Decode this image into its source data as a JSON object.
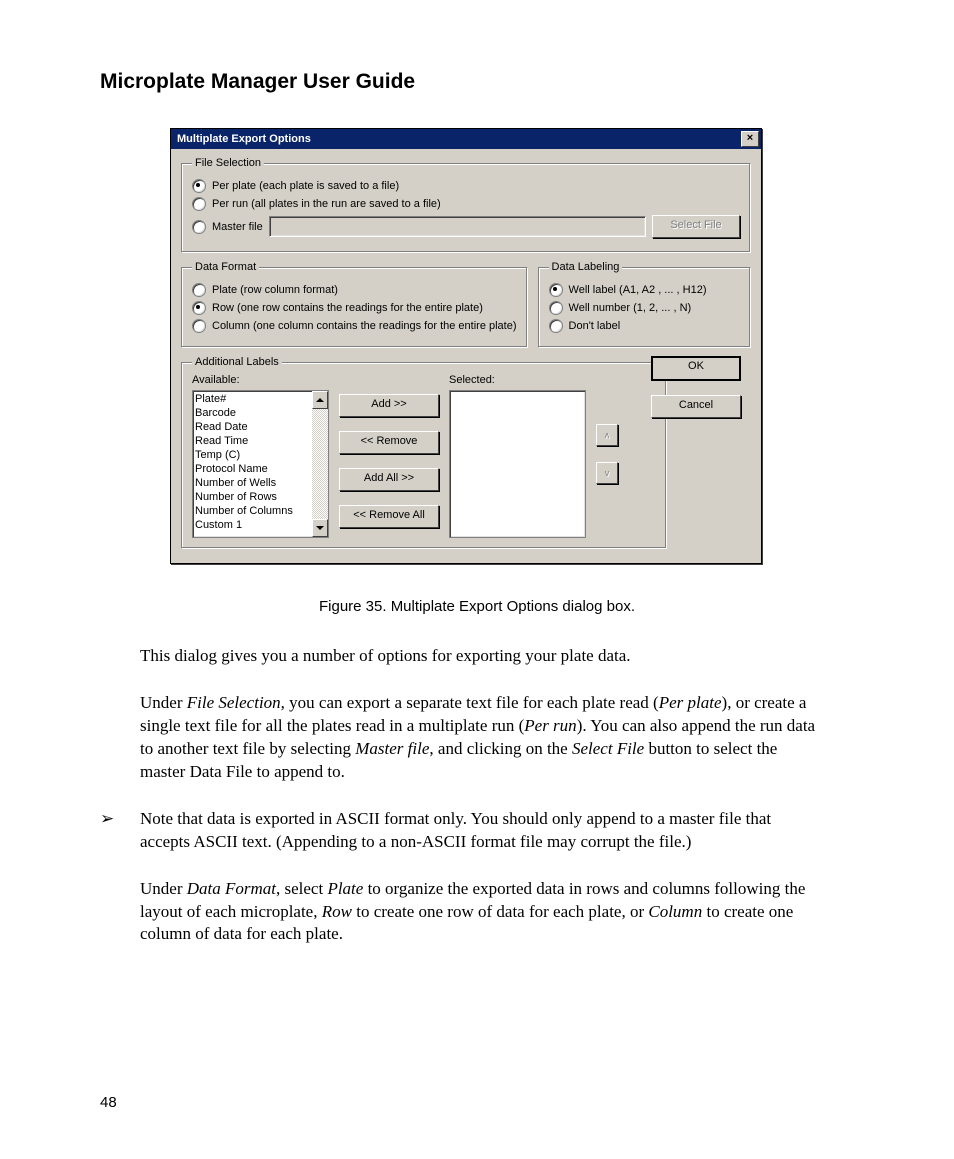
{
  "doc_title": "Microplate Manager User Guide",
  "page_number": "48",
  "dialog": {
    "title": "Multiplate Export Options",
    "file_selection": {
      "legend": "File Selection",
      "opt_per_plate": "Per plate (each plate is saved to a file)",
      "opt_per_run": "Per run (all plates in the run are saved to a file)",
      "opt_master_file": "Master file",
      "select_file_btn": "Select File"
    },
    "data_format": {
      "legend": "Data Format",
      "opt_plate": "Plate (row column format)",
      "opt_row": "Row (one row contains the readings for the entire plate)",
      "opt_column": "Column (one column contains the readings for the entire plate)"
    },
    "data_labeling": {
      "legend": "Data Labeling",
      "opt_well_label": "Well label (A1, A2 , ... , H12)",
      "opt_well_number": "Well number (1, 2, ... , N)",
      "opt_dont_label": "Don't label"
    },
    "additional_labels": {
      "legend": "Additional Labels",
      "available_hdr": "Available:",
      "selected_hdr": "Selected:",
      "items": [
        "Plate#",
        "Barcode",
        "Read Date",
        "Read Time",
        "Temp (C)",
        "Protocol Name",
        "Number of Wells",
        "Number of Rows",
        "Number of Columns",
        "Custom 1"
      ],
      "btn_add": "Add >>",
      "btn_remove": "<< Remove",
      "btn_add_all": "Add All >>",
      "btn_remove_all": "<< Remove All"
    },
    "ok_btn": "OK",
    "cancel_btn": "Cancel"
  },
  "figure_caption": "Figure 35.  Multiplate Export Options dialog box.",
  "para1": "This dialog gives you a number of options for exporting your plate data.",
  "para2_pre": "Under ",
  "para2_em1": "File Selection,",
  "para2_mid1": " you can export a separate text file for each plate read (",
  "para2_em2": "Per plate",
  "para2_mid2": "), or create a single text file for all the plates read in a multiplate run (",
  "para2_em3": "Per run",
  "para2_mid3": "). You can also append the run data to another text file by selecting ",
  "para2_em4": "Master file",
  "para2_mid4": ", and clicking on the ",
  "para2_em5": "Select File",
  "para2_end": " button to select the master Data File to append to.",
  "note_text": "Note that data is exported in ASCII format only. You should only append to a master file that accepts ASCII text. (Appending to a non-ASCII format file may corrupt the file.)",
  "para3_pre": "Under ",
  "para3_em1": "Data Format",
  "para3_mid1": ", select ",
  "para3_em2": "Plate",
  "para3_mid2": " to organize the exported data in rows and columns following the layout of each microplate, ",
  "para3_em3": "Row",
  "para3_mid3": " to create one row of data for each plate, or ",
  "para3_em4": "Column",
  "para3_end": " to create one column of data for each plate."
}
